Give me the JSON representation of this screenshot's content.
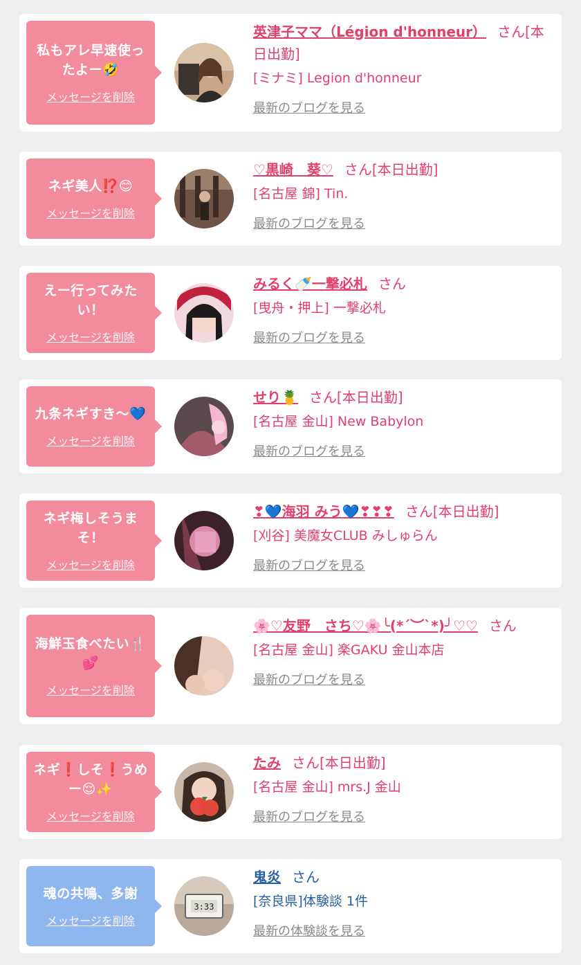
{
  "delete_label": "メッセージを削除",
  "items": [
    {
      "message": "私もアレ早速使ったよー🤣",
      "name": "英津子ママ（Légion d'honneur）",
      "suffix": "さん[本日出勤]",
      "shop": "[ミナミ] Legion d'honneur",
      "link": "最新のブログを見る",
      "color": "pink"
    },
    {
      "message": "ネギ美人⁉️😊",
      "name": "♡黒崎　葵♡",
      "suffix": "さん[本日出勤]",
      "shop": "[名古屋 錦] Tin.",
      "link": "最新のブログを見る",
      "color": "pink"
    },
    {
      "message": "えー行ってみたい！",
      "name": "みるく🍼一撃必札",
      "suffix": "さん",
      "shop": "[曳舟・押上] 一撃必札",
      "link": "最新のブログを見る",
      "color": "pink"
    },
    {
      "message": "九条ネギすき〜💙",
      "name": "せり🍍",
      "suffix": "さん[本日出勤]",
      "shop": "[名古屋 金山] New Babylon",
      "link": "最新のブログを見る",
      "color": "pink"
    },
    {
      "message": "ネギ梅しそうまそ！",
      "name": "❣💙海羽 みう💙❣❣❣",
      "suffix": "さん[本日出勤]",
      "shop": "[刈谷] 美魔女CLUB みしゅらん",
      "link": "最新のブログを見る",
      "color": "pink"
    },
    {
      "message": "海鮮玉食べたい🍴💕",
      "name": "🌸♡友野　さち♡🌸╰(*´︶`*)╯♡♡",
      "suffix": "さん",
      "shop": "[名古屋 金山] 楽GAKU 金山本店",
      "link": "最新のブログを見る",
      "color": "pink"
    },
    {
      "message": "ネギ❗️しそ❗️うめー😌✨",
      "name": "たみ",
      "suffix": "さん[本日出勤]",
      "shop": "[名古屋 金山] mrs.J 金山",
      "link": "最新のブログを見る",
      "color": "pink"
    },
    {
      "message": "魂の共鳴、多謝",
      "name": "鬼炎",
      "suffix": "さん",
      "shop": "[奈良県]体験談 1件",
      "link": "最新の体験談を見る",
      "color": "blue",
      "avatar_text": "3:33"
    }
  ]
}
